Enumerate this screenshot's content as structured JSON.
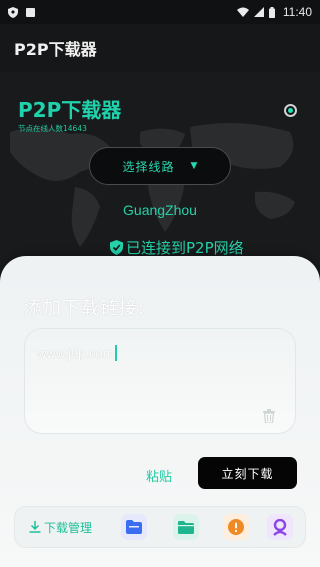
{
  "status_bar": {
    "time": "11:40"
  },
  "app_bar": {
    "title": "P2P下载器"
  },
  "hero": {
    "brand_title": "P2P下载器",
    "node_count": "节点在线人数14643",
    "route_button": "选择线路",
    "city": "GuangZhou",
    "connection_status": "已连接到P2P网络"
  },
  "sheet": {
    "title": "添加下载链接:",
    "link_value": "www.j9p.com",
    "paste_label": "粘贴",
    "download_label": "立刻下载"
  },
  "toolbar": {
    "manage_label": "下载管理"
  },
  "colors": {
    "accent": "#25d1a9",
    "dark_bg": "#141516",
    "sheet_bg": "#f3f6f6",
    "button_dark": "#050505"
  },
  "icons": [
    "shield-icon",
    "square-icon",
    "wifi-icon",
    "signal-icon",
    "battery-icon",
    "check-shield-icon",
    "caret-down-icon",
    "trash-icon",
    "download-icon",
    "folder-blue-icon",
    "folder-green-icon",
    "info-orange-icon",
    "user-purple-icon"
  ]
}
